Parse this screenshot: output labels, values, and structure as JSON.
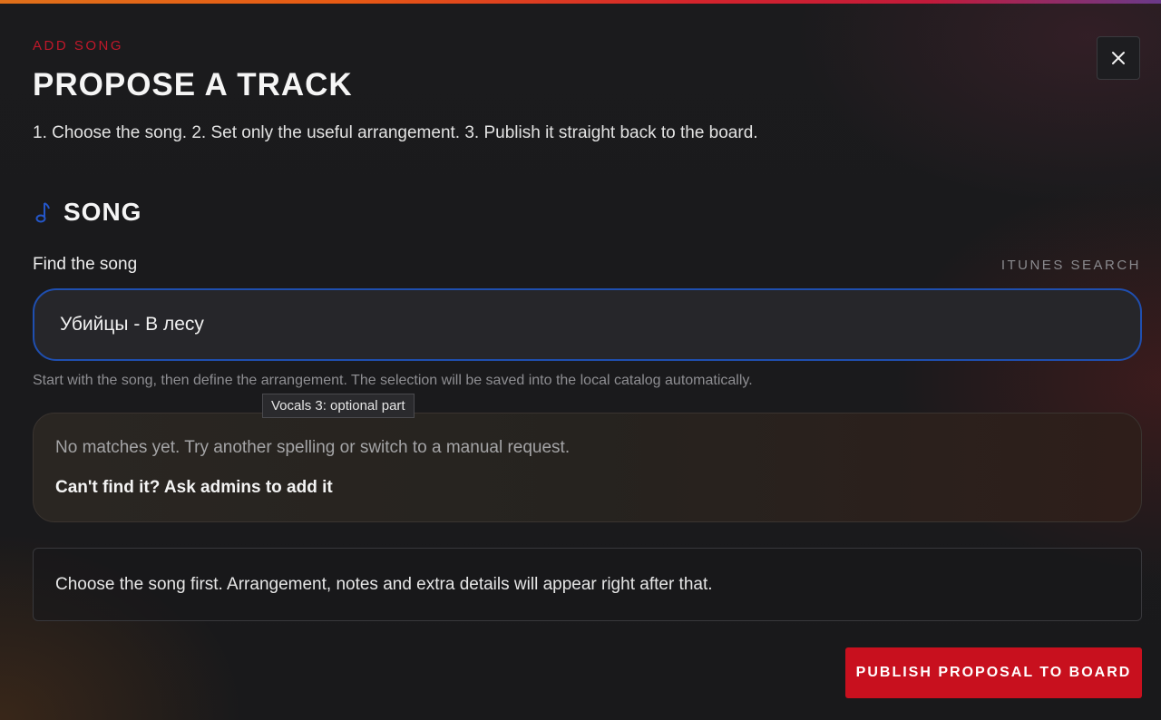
{
  "dialog": {
    "eyebrow": "ADD SONG",
    "title": "PROPOSE A TRACK",
    "subtitle": "1. Choose the song. 2. Set only the useful arrangement. 3. Publish it straight back to the board.",
    "close_icon": "close-icon"
  },
  "song_section": {
    "icon": "music-note-icon",
    "title": "SONG",
    "field_label": "Find the song",
    "field_aside": "ITUNES SEARCH",
    "search_value": "Убийцы - В лесу",
    "helper_text": "Start with the song, then define the arrangement. The selection will be saved into the local catalog automatically.",
    "tooltip": "Vocals 3: optional part"
  },
  "results": {
    "empty_message": "No matches yet. Try another spelling or switch to a manual request.",
    "manual_request_label": "Can't find it? Ask admins to add it"
  },
  "info": {
    "message": "Choose the song first. Arrangement, notes and extra details will appear right after that."
  },
  "actions": {
    "publish_label": "PUBLISH PROPOSAL TO BOARD"
  },
  "colors": {
    "accent": "#c8101e",
    "focus_border": "#1f4fb0"
  }
}
